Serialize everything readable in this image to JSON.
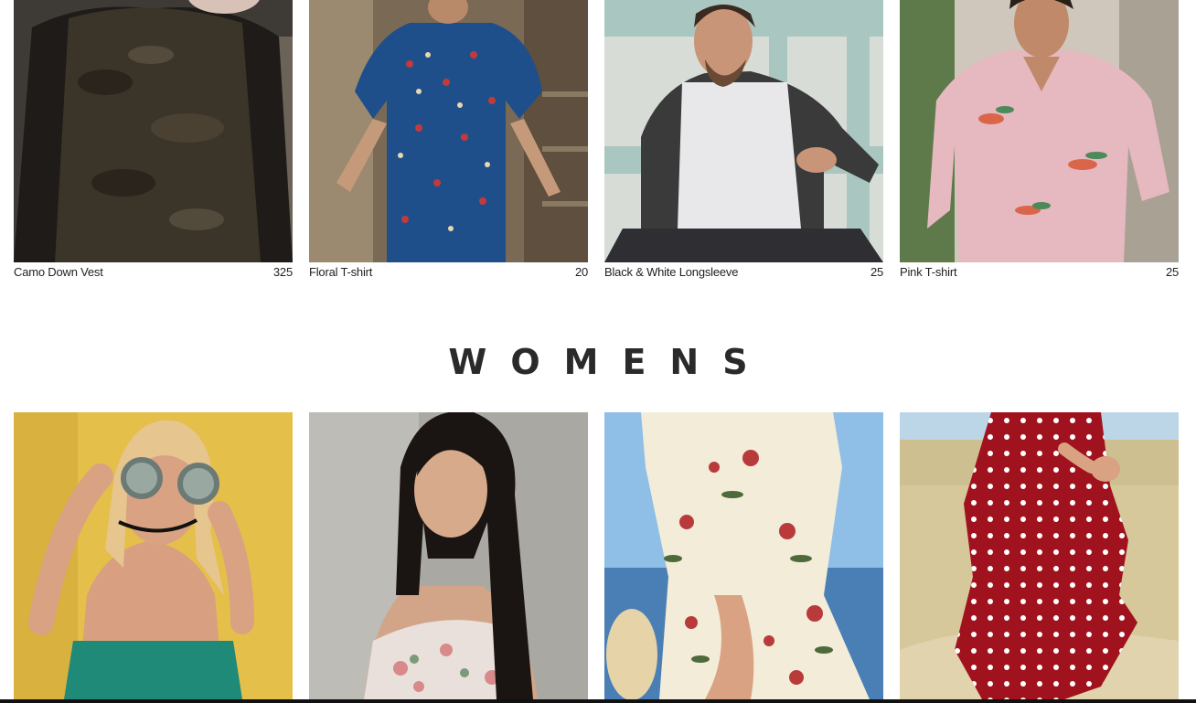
{
  "men": {
    "products": [
      {
        "name": "Camo Down Vest",
        "price": "325",
        "image": "man-camo-vest-photo"
      },
      {
        "name": "Floral T-shirt",
        "price": "20",
        "image": "man-floral-shirt-photo"
      },
      {
        "name": "Black & White Longsleeve",
        "price": "25",
        "image": "man-raglan-longsleeve-photo"
      },
      {
        "name": "Pink T-shirt",
        "price": "25",
        "image": "man-pink-shirt-photo"
      }
    ]
  },
  "women": {
    "title": "WOMENS",
    "products": [
      {
        "image": "woman-sunglasses-yellow-wall-photo"
      },
      {
        "image": "woman-floral-offshoulder-photo"
      },
      {
        "image": "woman-floral-wrap-dress-photo"
      },
      {
        "image": "woman-red-polka-dress-photo"
      }
    ]
  },
  "colors": {
    "text": "#222222",
    "background": "#ffffff"
  }
}
